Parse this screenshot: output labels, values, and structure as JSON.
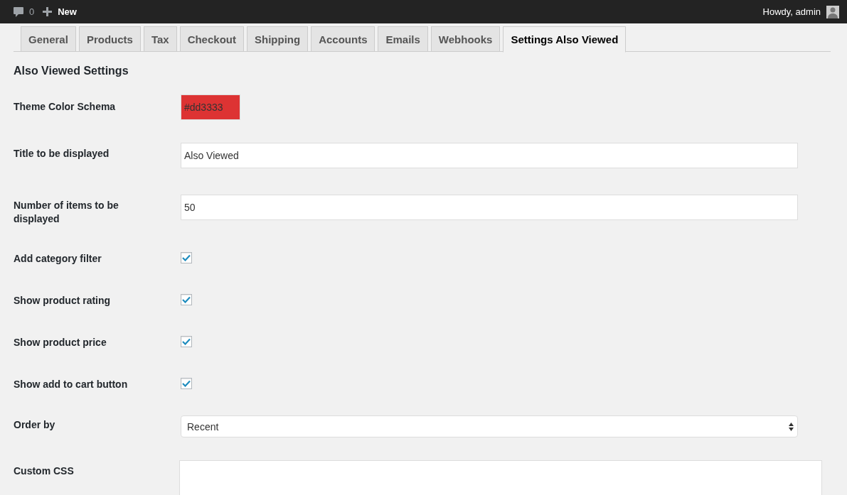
{
  "admin_bar": {
    "comments_count": "0",
    "new_label": "New",
    "greeting": "Howdy, admin"
  },
  "tabs": [
    {
      "label": "General",
      "selected": false
    },
    {
      "label": "Products",
      "selected": false
    },
    {
      "label": "Tax",
      "selected": false
    },
    {
      "label": "Checkout",
      "selected": false
    },
    {
      "label": "Shipping",
      "selected": false
    },
    {
      "label": "Accounts",
      "selected": false
    },
    {
      "label": "Emails",
      "selected": false
    },
    {
      "label": "Webhooks",
      "selected": false
    },
    {
      "label": "Settings Also Viewed",
      "selected": true
    }
  ],
  "heading": "Also Viewed Settings",
  "fields": [
    {
      "kind": "color",
      "label": "Theme Color Schema",
      "value": "#dd3333",
      "color": "#dd3333"
    },
    {
      "kind": "text",
      "label": "Title to be displayed",
      "value": "Also Viewed"
    },
    {
      "kind": "text",
      "label": "Number of items to be displayed",
      "value": "50"
    },
    {
      "kind": "checkbox",
      "label": "Add category filter",
      "checked": true
    },
    {
      "kind": "checkbox",
      "label": "Show product rating",
      "checked": true
    },
    {
      "kind": "checkbox",
      "label": "Show product price",
      "checked": true
    },
    {
      "kind": "checkbox",
      "label": "Show add to cart button",
      "checked": true
    },
    {
      "kind": "select",
      "label": "Order by",
      "value": "Recent"
    },
    {
      "kind": "textarea",
      "label": "Custom CSS"
    }
  ]
}
